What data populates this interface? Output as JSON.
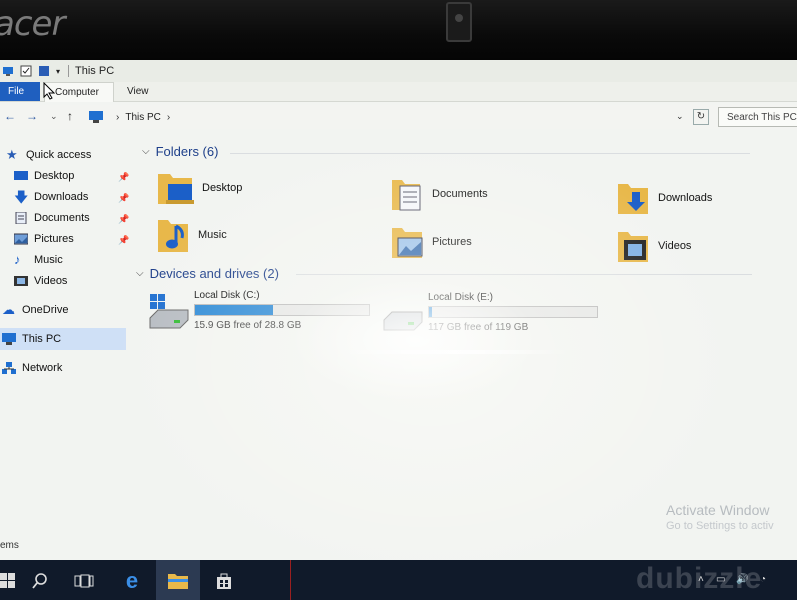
{
  "bezel": {
    "brand": "acer"
  },
  "titlebar": {
    "title": "This PC"
  },
  "ribbon": {
    "tabs": [
      "File",
      "Computer",
      "View"
    ]
  },
  "address": {
    "path": [
      "This PC"
    ],
    "search_placeholder": "Search This PC"
  },
  "nav": {
    "quick_access": "Quick access",
    "items": [
      {
        "label": "Desktop",
        "pinned": true
      },
      {
        "label": "Downloads",
        "pinned": true
      },
      {
        "label": "Documents",
        "pinned": true
      },
      {
        "label": "Pictures",
        "pinned": true
      },
      {
        "label": "Music",
        "pinned": false
      },
      {
        "label": "Videos",
        "pinned": false
      }
    ],
    "onedrive": "OneDrive",
    "this_pc": "This PC",
    "network": "Network"
  },
  "folders": {
    "header": "Folders (6)",
    "items": [
      "Desktop",
      "Documents",
      "Downloads",
      "Music",
      "Pictures",
      "Videos"
    ]
  },
  "drives": {
    "header": "Devices and drives (2)",
    "items": [
      {
        "name": "Local Disk (C:)",
        "free_text": "15.9 GB free of 28.8 GB",
        "used_fraction": 0.45
      },
      {
        "name": "Local Disk (E:)",
        "free_text": "117 GB free of 119 GB",
        "used_fraction": 0.02
      }
    ]
  },
  "status": {
    "text": "ems"
  },
  "activation": {
    "title": "Activate Window",
    "subtitle": "Go to Settings to activ"
  },
  "watermark": "dubizzle",
  "colors": {
    "accent": "#1f5fbf",
    "drive_fill": "#2d8ad6",
    "taskbar": "#101a2a"
  }
}
